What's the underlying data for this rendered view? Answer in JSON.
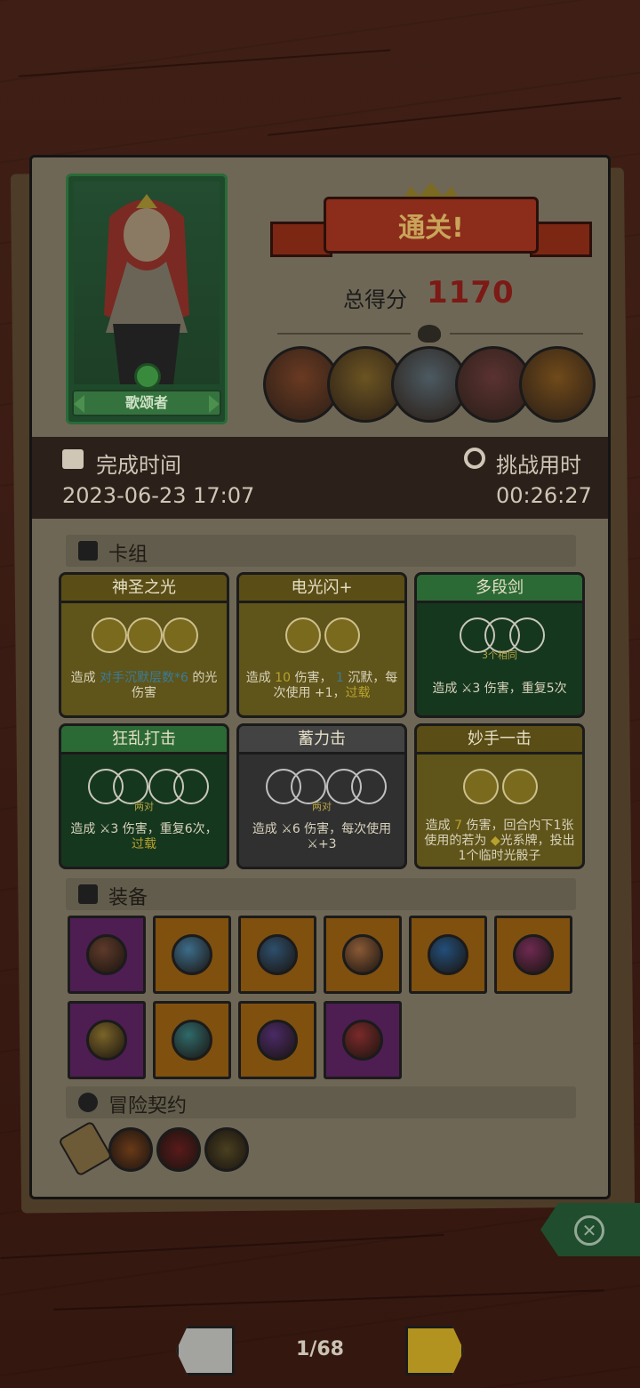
{
  "hero": {
    "name": "歌颂者"
  },
  "result": {
    "banner": "通关!",
    "score_label": "总得分",
    "score_value": "1170"
  },
  "bosses": [
    {
      "icon": "cyclops-boss-icon",
      "color": "#6a3a22"
    },
    {
      "icon": "warrior-boss-icon",
      "color": "#6b5422"
    },
    {
      "icon": "yeti-boss-icon",
      "color": "#4c5a62"
    },
    {
      "icon": "demon-boss-icon",
      "color": "#5a3232"
    },
    {
      "icon": "crystal-golem-boss-icon",
      "color": "#704a1a"
    }
  ],
  "times": {
    "finish_label": "完成时间",
    "finish_value": "2023-06-23 17:07",
    "challenge_label": "挑战用时",
    "challenge_value": "00:26:27"
  },
  "sections": {
    "deck": "卡组",
    "equipment": "装备",
    "contract": "冒险契约"
  },
  "deck": [
    {
      "title": "神圣之光",
      "style": "gold",
      "slots": 3,
      "sub": "",
      "desc_a": "造成",
      "desc_kw1": "对手沉默层数*6",
      "desc_b": "的光伤害",
      "desc_kw2": "",
      "desc_c": ""
    },
    {
      "title": "电光闪+",
      "style": "gold",
      "slots": 2,
      "sub": "",
      "desc_a": "造成",
      "desc_kw1": "10",
      "desc_b": "伤害，",
      "desc_kw2": "1",
      "desc_c": "沉默，每次使用 +1，",
      "desc_kw3": "过载"
    },
    {
      "title": "多段剑",
      "style": "green",
      "slots": 3,
      "sub": "3个相同",
      "desc_a": "造成",
      "desc_kw1": "",
      "desc_b": "3 伤害，重复5次",
      "desc_kw2": "",
      "desc_c": ""
    },
    {
      "title": "狂乱打击",
      "style": "green",
      "slots": 4,
      "sub": "两对",
      "desc_a": "造成",
      "desc_kw1": "",
      "desc_b": "3 伤害，重复6次，",
      "desc_kw2": "",
      "desc_c": "",
      "desc_kw3": "过载"
    },
    {
      "title": "蓄力击",
      "style": "gray",
      "slots": 4,
      "sub": "两对",
      "desc_a": "造成",
      "desc_kw1": "",
      "desc_b": "6 伤害，每次使用",
      "desc_kw2": "",
      "desc_c": "+3"
    },
    {
      "title": "妙手一击",
      "style": "gold",
      "slots": 2,
      "sub": "",
      "desc_a": "造成",
      "desc_kw1": "7",
      "desc_b": "伤害，回合内下1张使用的若为",
      "desc_kw2": "",
      "desc_c": "光系牌，投出1个临时光骰子"
    }
  ],
  "equipment": [
    {
      "icon": "button-shield-icon",
      "rarity": "purple",
      "color": "#5e3a2a"
    },
    {
      "icon": "blue-pebbles-icon",
      "rarity": "orange",
      "color": "#3d6d8a"
    },
    {
      "icon": "hexagram-amulet-icon",
      "rarity": "orange",
      "color": "#2d4f6c"
    },
    {
      "icon": "ring-medallion-icon",
      "rarity": "orange",
      "color": "#8a5a36"
    },
    {
      "icon": "spiked-orb-icon",
      "rarity": "orange",
      "color": "#234f7a"
    },
    {
      "icon": "yin-yang-orb-icon",
      "rarity": "orange",
      "color": "#6e2a52"
    },
    {
      "icon": "golden-dice-icon",
      "rarity": "purple",
      "color": "#7a6428"
    },
    {
      "icon": "flame-crystal-icon",
      "rarity": "orange",
      "color": "#2f6a6a"
    },
    {
      "icon": "purple-hood-icon",
      "rarity": "orange",
      "color": "#4a2a66"
    },
    {
      "icon": "ruby-ring-icon",
      "rarity": "purple",
      "color": "#7a2a2a"
    }
  ],
  "contracts": [
    {
      "icon": "flame-contract-icon",
      "color": "#6a3a18"
    },
    {
      "icon": "red-rune-contract-icon",
      "color": "#5a1a1a"
    },
    {
      "icon": "lantern-contract-icon",
      "color": "#4a4020"
    }
  ],
  "pager": {
    "text": "1/68"
  }
}
